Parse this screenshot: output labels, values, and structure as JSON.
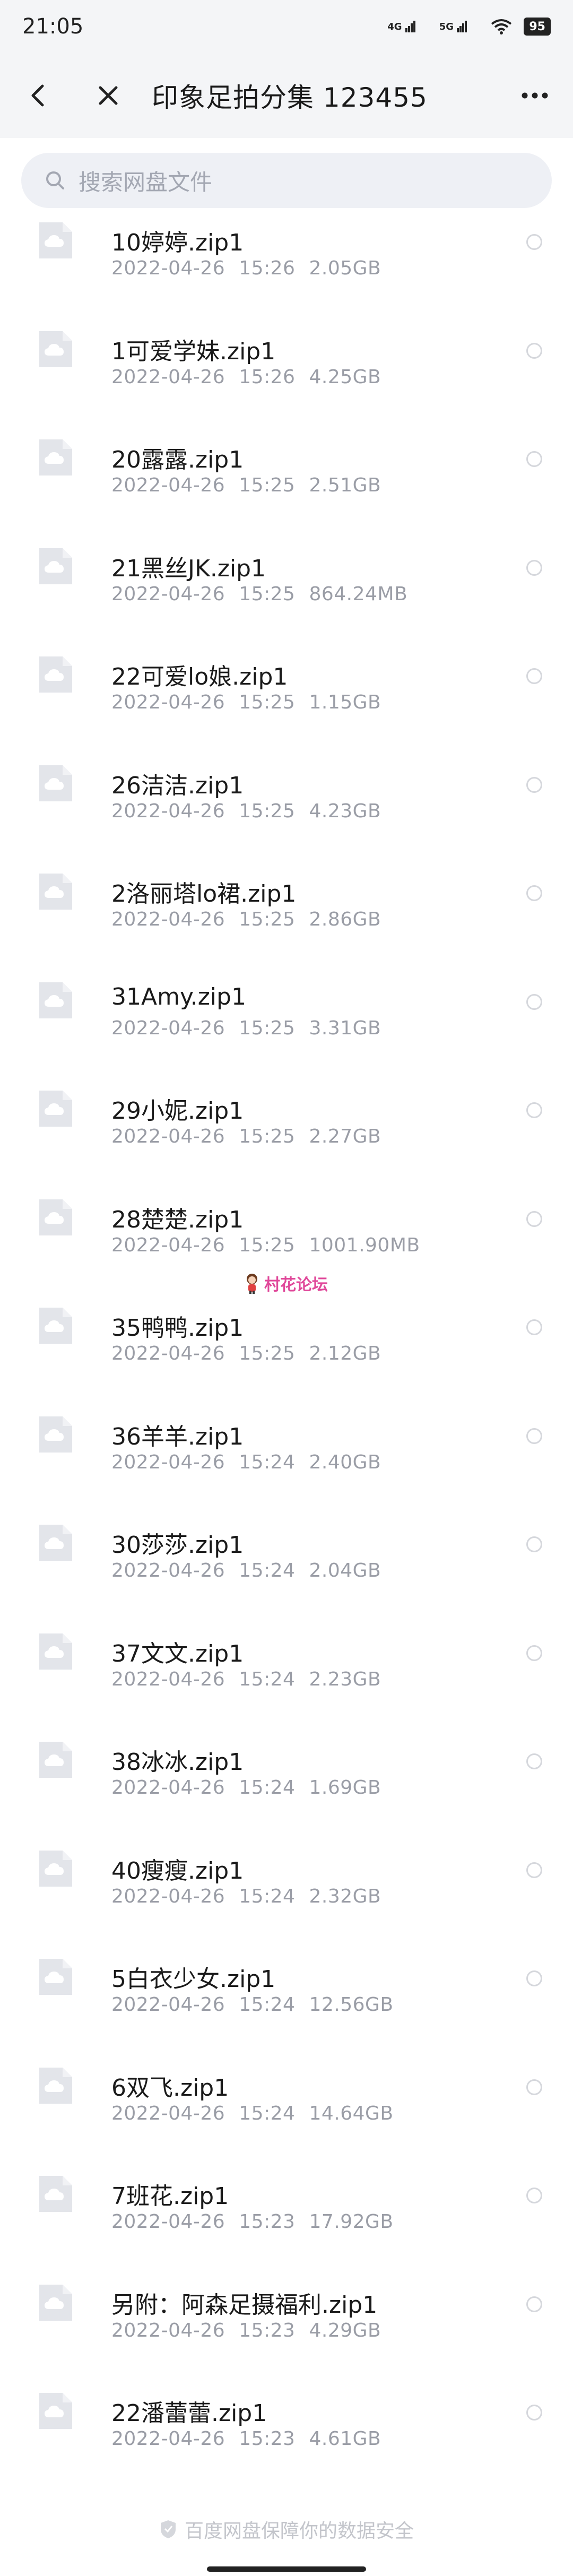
{
  "status": {
    "time": "21:05",
    "signal1": "4G",
    "signal2": "5G",
    "battery": "95"
  },
  "header": {
    "title": "印象足拍分集 123455"
  },
  "search": {
    "placeholder": "搜索网盘文件"
  },
  "files": [
    {
      "name": "10婷婷.zip1",
      "date": "2022-04-26",
      "time": "15:26",
      "size": "2.05GB"
    },
    {
      "name": "1可爱学妹.zip1",
      "date": "2022-04-26",
      "time": "15:26",
      "size": "4.25GB"
    },
    {
      "name": "20露露.zip1",
      "date": "2022-04-26",
      "time": "15:25",
      "size": "2.51GB"
    },
    {
      "name": "21黑丝JK.zip1",
      "date": "2022-04-26",
      "time": "15:25",
      "size": "864.24MB"
    },
    {
      "name": "22可爱lo娘.zip1",
      "date": "2022-04-26",
      "time": "15:25",
      "size": "1.15GB"
    },
    {
      "name": "26洁洁.zip1",
      "date": "2022-04-26",
      "time": "15:25",
      "size": "4.23GB"
    },
    {
      "name": "2洛丽塔lo裙.zip1",
      "date": "2022-04-26",
      "time": "15:25",
      "size": "2.86GB"
    },
    {
      "name": "31Amy.zip1",
      "date": "2022-04-26",
      "time": "15:25",
      "size": "3.31GB"
    },
    {
      "name": "29小妮.zip1",
      "date": "2022-04-26",
      "time": "15:25",
      "size": "2.27GB"
    },
    {
      "name": "28楚楚.zip1",
      "date": "2022-04-26",
      "time": "15:25",
      "size": "1001.90MB"
    },
    {
      "name": "35鸭鸭.zip1",
      "date": "2022-04-26",
      "time": "15:25",
      "size": "2.12GB"
    },
    {
      "name": "36羊羊.zip1",
      "date": "2022-04-26",
      "time": "15:24",
      "size": "2.40GB"
    },
    {
      "name": "30莎莎.zip1",
      "date": "2022-04-26",
      "time": "15:24",
      "size": "2.04GB"
    },
    {
      "name": "37文文.zip1",
      "date": "2022-04-26",
      "time": "15:24",
      "size": "2.23GB"
    },
    {
      "name": "38冰冰.zip1",
      "date": "2022-04-26",
      "time": "15:24",
      "size": "1.69GB"
    },
    {
      "name": "40瘦瘦.zip1",
      "date": "2022-04-26",
      "time": "15:24",
      "size": "2.32GB"
    },
    {
      "name": "5白衣少女.zip1",
      "date": "2022-04-26",
      "time": "15:24",
      "size": "12.56GB"
    },
    {
      "name": "6双飞.zip1",
      "date": "2022-04-26",
      "time": "15:24",
      "size": "14.64GB"
    },
    {
      "name": "7班花.zip1",
      "date": "2022-04-26",
      "time": "15:23",
      "size": "17.92GB"
    },
    {
      "name": "另附：阿森足摄福利.zip1",
      "date": "2022-04-26",
      "time": "15:23",
      "size": "4.29GB"
    },
    {
      "name": "22潘蕾蕾.zip1",
      "date": "2022-04-26",
      "time": "15:23",
      "size": "4.61GB"
    }
  ],
  "watermark": "村花论坛",
  "footer": "百度网盘保障你的数据安全",
  "colors": {
    "background": "#ffffff",
    "header_bg": "#f4f5f7",
    "search_bg": "#eef0f5",
    "meta_text": "#9a9da6",
    "file_icon": "#e3e5ea"
  }
}
